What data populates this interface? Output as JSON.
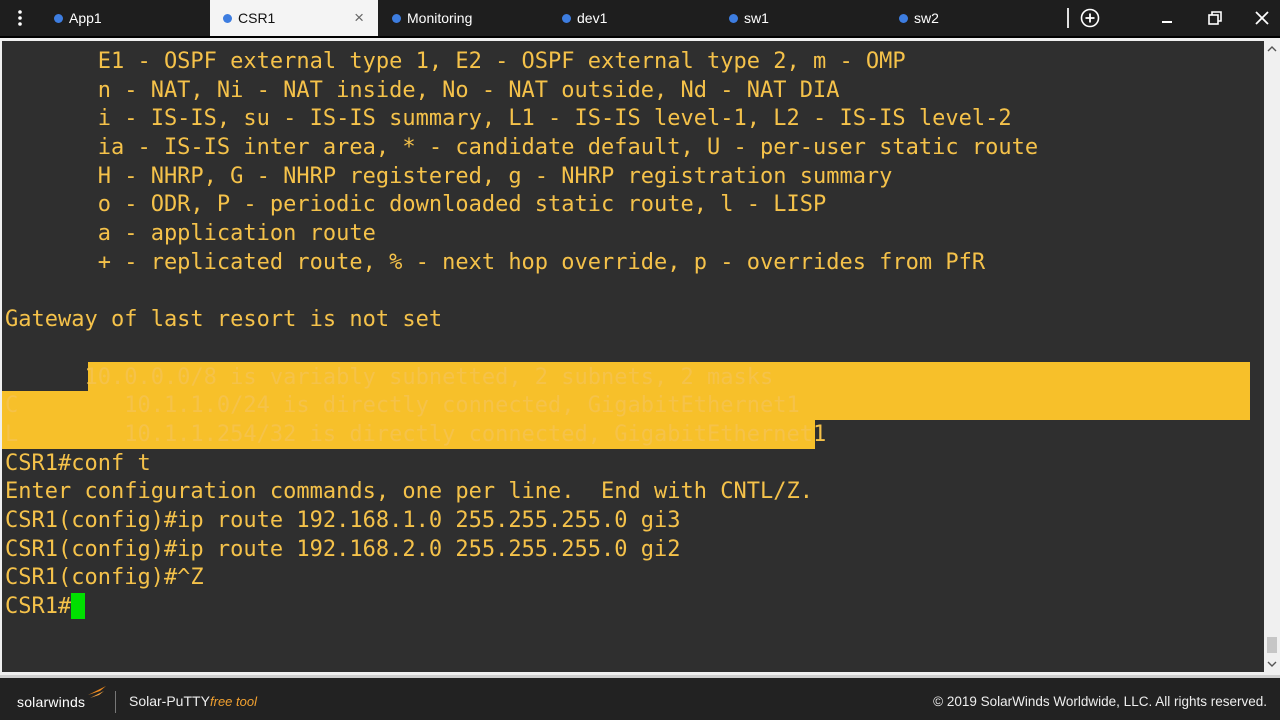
{
  "tabs": [
    {
      "label": "App1",
      "active": false
    },
    {
      "label": "CSR1",
      "active": true
    },
    {
      "label": "Monitoring",
      "active": false
    },
    {
      "label": "dev1",
      "active": false
    },
    {
      "label": "sw1",
      "active": false
    },
    {
      "label": "sw2",
      "active": false
    }
  ],
  "tab_close_symbol": "×",
  "icons": {
    "menu": "vertical-dots-icon",
    "new_tab": "plus-circle-icon",
    "minimize": "minimize-icon",
    "restore": "restore-icon",
    "close": "close-icon"
  },
  "colors": {
    "terminal_bg": "#2f2f2f",
    "terminal_text": "#f5c24a",
    "selection": "#f7c02a",
    "cursor": "#00e000",
    "tab_dot": "#3d7de0"
  },
  "terminal": {
    "lines": [
      "       E1 - OSPF external type 1, E2 - OSPF external type 2, m - OMP",
      "       n - NAT, Ni - NAT inside, No - NAT outside, Nd - NAT DIA",
      "       i - IS-IS, su - IS-IS summary, L1 - IS-IS level-1, L2 - IS-IS level-2",
      "       ia - IS-IS inter area, * - candidate default, U - per-user static route",
      "       H - NHRP, G - NHRP registered, g - NHRP registration summary",
      "       o - ODR, P - periodic downloaded static route, l - LISP",
      "       a - application route",
      "       + - replicated route, % - next hop override, p - overrides from PfR",
      "",
      "Gateway of last resort is not set",
      "",
      "      10.0.0.0/8 is variably subnetted, 2 subnets, 2 masks",
      "C        10.1.1.0/24 is directly connected, GigabitEthernet1",
      "L        10.1.1.254/32 is directly connected, GigabitEthernet1",
      "CSR1#conf t",
      "Enter configuration commands, one per line.  End with CNTL/Z.",
      "CSR1(config)#ip route 192.168.1.0 255.255.255.0 gi3",
      "CSR1(config)#ip route 192.168.2.0 255.255.255.0 gi2",
      "CSR1(config)#^Z",
      "CSR1#"
    ]
  },
  "footer": {
    "brand": "solarwinds",
    "product": "Solar-PuTTY",
    "free_tool": "free tool",
    "copyright": "© 2019 SolarWinds Worldwide, LLC. All rights reserved."
  }
}
